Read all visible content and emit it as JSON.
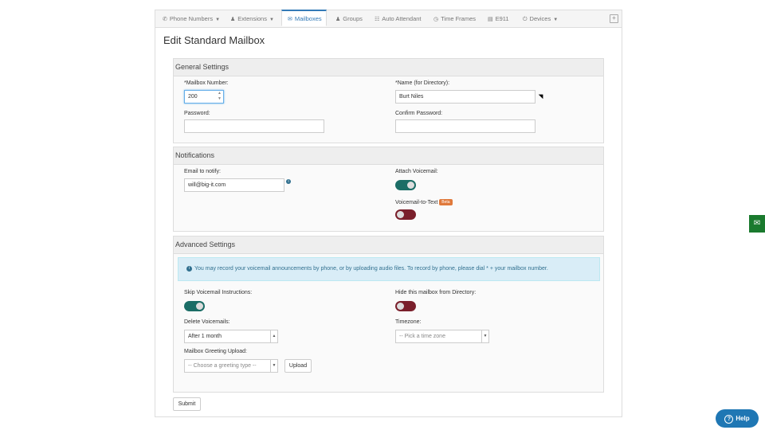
{
  "tabs": [
    {
      "label": "Phone Numbers",
      "icon": "phone-icon",
      "dropdown": true
    },
    {
      "label": "Extensions",
      "icon": "users-icon",
      "dropdown": true
    },
    {
      "label": "Mailboxes",
      "icon": "envelope-icon",
      "active": true
    },
    {
      "label": "Groups",
      "icon": "users-icon"
    },
    {
      "label": "Auto Attendant",
      "icon": "sitemap-icon"
    },
    {
      "label": "Time Frames",
      "icon": "clock-icon"
    },
    {
      "label": "E911",
      "icon": "document-icon"
    },
    {
      "label": "Devices",
      "icon": "power-icon",
      "dropdown": true
    }
  ],
  "page": {
    "title": "Edit Standard Mailbox"
  },
  "general": {
    "heading": "General Settings",
    "mailbox_number_label": "*Mailbox Number:",
    "mailbox_number_value": "200",
    "name_label": "*Name (for Directory):",
    "name_value": "Burt Niles",
    "password_label": "Password:",
    "confirm_password_label": "Confirm Password:"
  },
  "notifications": {
    "heading": "Notifications",
    "email_label": "Email to notify:",
    "email_value": "will@big-it.com",
    "attach_label": "Attach Voicemail:",
    "attach_on": true,
    "vtt_label": "Voicemail-to-Text",
    "vtt_badge": "Beta",
    "vtt_on": false
  },
  "advanced": {
    "heading": "Advanced Settings",
    "info_text": "You may record your voicemail announcements by phone, or by uploading audio files. To record by phone, please dial * + your mailbox number.",
    "skip_label": "Skip Voicemail Instructions:",
    "skip_on": true,
    "hide_label": "Hide this mailbox from Directory:",
    "hide_on": false,
    "delete_label": "Delete Voicemails:",
    "delete_value": "After 1 month",
    "timezone_label": "Timezone:",
    "timezone_placeholder": "-- Pick a time zone",
    "greeting_label": "Mailbox Greeting Upload:",
    "greeting_placeholder": "-- Choose a greeting type --",
    "upload_label": "Upload"
  },
  "submit_label": "Submit",
  "help_label": "Help",
  "colors": {
    "accent": "#337ab7",
    "toggle_on": "#1b6d66",
    "toggle_off": "#7a1f2b",
    "help": "#1f77b4",
    "chat": "#1a7a2e"
  }
}
